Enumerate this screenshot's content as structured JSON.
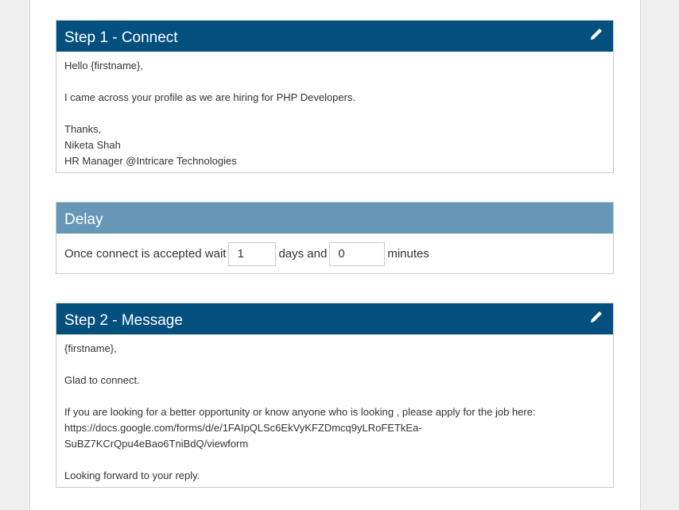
{
  "step1": {
    "title": "Step 1 - Connect",
    "lines": [
      "Hello {firstname},",
      "",
      "I came across your profile as we are hiring for PHP Developers.",
      "",
      "Thanks,",
      "Niketa Shah",
      "HR Manager @Intricare Technologies"
    ]
  },
  "delay": {
    "title": "Delay",
    "prefix": "Once connect is accepted wait",
    "days_value": "1",
    "days_label": "days and",
    "minutes_value": "0",
    "minutes_label": "minutes"
  },
  "step2": {
    "title": "Step 2 - Message",
    "lines": [
      "{firstname},",
      "",
      "Glad to connect.",
      "",
      "If you are looking for a better opportunity or know anyone who is looking , please apply for the job here:",
      "https://docs.google.com/forms/d/e/1FAIpQLSc6EkVyKFZDmcq9yLRoFETkEa-",
      "SuBZ7KCrQpu4eBao6TniBdQ/viewform",
      "",
      "Looking forward to your reply."
    ]
  },
  "colors": {
    "header_dark": "#03507f",
    "header_light": "#6797b6"
  },
  "icons": {
    "edit": "pencil-icon"
  }
}
